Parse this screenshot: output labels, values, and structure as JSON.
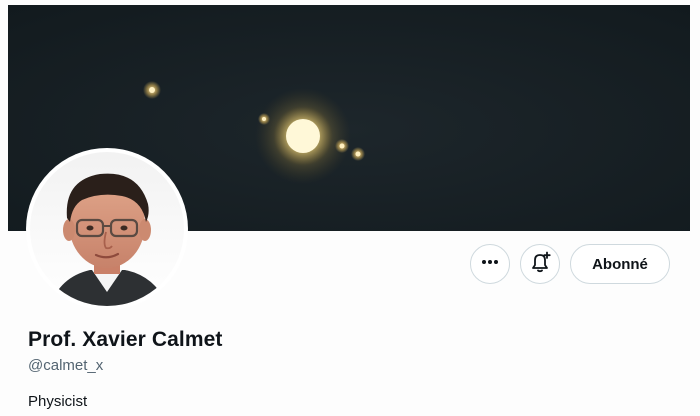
{
  "profile": {
    "display_name": "Prof. Xavier Calmet",
    "handle": "@calmet_x",
    "bio": "Physicist"
  },
  "actions": {
    "more_icon": "more-icon",
    "notify_icon": "bell-plus-icon",
    "follow_label": "Abonné"
  },
  "colors": {
    "text_primary": "#0f1419",
    "text_secondary": "#536471",
    "button_border": "#cfd9de",
    "banner_sky": "#161d22"
  }
}
